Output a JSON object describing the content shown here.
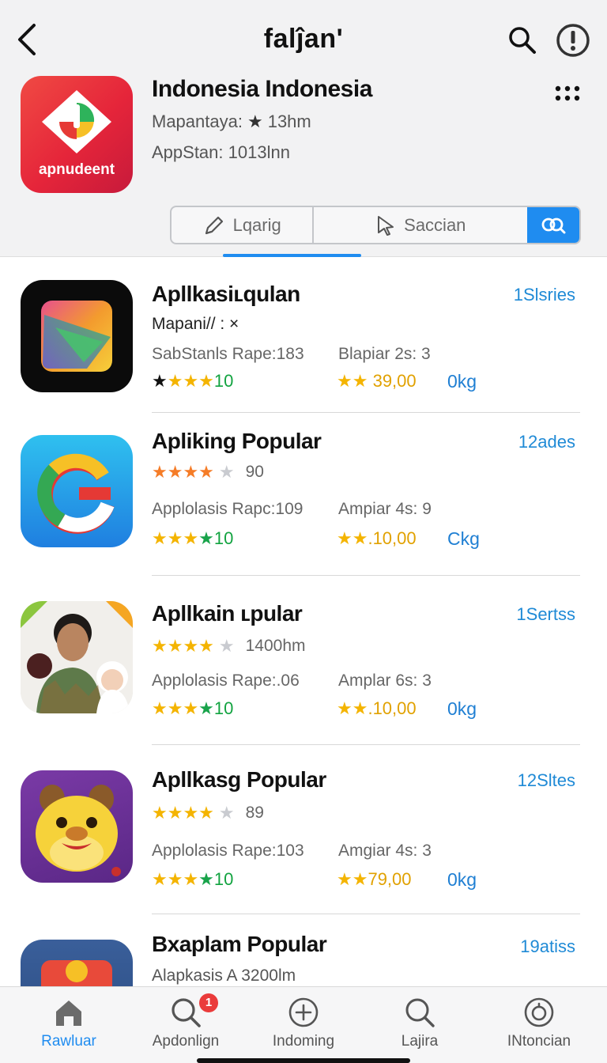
{
  "header": {
    "title": "falĵan'",
    "back_icon": "chevron-left-icon",
    "search_icon": "search-icon",
    "info_icon": "info-icon"
  },
  "app": {
    "name": "Indonesia Indonesia",
    "icon_brand": "apnudeent",
    "meta1_label": "Mapantaya:",
    "meta1_value": "13hm",
    "meta2": "AppStan: 1013lnn",
    "more_icon": "more-dots-icon"
  },
  "segment": {
    "tab1_label": "Lqarig",
    "tab2_label": "Saccian",
    "active_index": 0
  },
  "items": [
    {
      "title": "Apllkasiʟqulan",
      "tag": "1Slsries",
      "sub": "Mapani// : ×",
      "rating_fill": null,
      "left_info": "SabStanls Rape:183",
      "right_info": "Blapiar 2s: 3",
      "left_score": "10",
      "right_score": "39,00",
      "size": "0kg",
      "icon": "stack-icon"
    },
    {
      "title": "Apliking Popular",
      "tag": "12ades",
      "rating": 4,
      "rating_count": "90",
      "left_info": "Applolasis Rapc:109",
      "right_info": "Ampiar 4s: 9",
      "left_score": "10",
      "right_score": ".10,00",
      "size": "Ckg",
      "icon": "g-logo-icon"
    },
    {
      "title": "Apllkain ʟpular",
      "tag": "1Sertss",
      "rating": 4,
      "rating_count": "1400hm",
      "left_info": "Applolasis Rape:.06",
      "right_info": "Amplar 6s: 3",
      "left_score": "10",
      "right_score": ".10,00",
      "size": "0kg",
      "icon": "family-photo-icon"
    },
    {
      "title": "Apllkasg Popular",
      "tag": "12Sltes",
      "rating": 4,
      "rating_count": "89",
      "left_info": "Applolasis Rape:103",
      "right_info": "Amgiar 4s: 3",
      "left_score": "10",
      "right_score": "79,00",
      "size": "0kg",
      "icon": "cartoon-creature-icon"
    },
    {
      "title": "Bxaplam Popular",
      "tag": "19atiss",
      "sub": "Alapkasis A 3200lm",
      "icon": "app-icon"
    }
  ],
  "tabbar": {
    "tabs": [
      {
        "label": "Rawluar",
        "icon": "home-icon"
      },
      {
        "label": "Apdonlign",
        "icon": "search-icon",
        "badge": "1"
      },
      {
        "label": "Indoming",
        "icon": "plus-circle-icon"
      },
      {
        "label": "Lajira",
        "icon": "search-icon"
      },
      {
        "label": "INtoncian",
        "icon": "settings-circle-icon"
      }
    ],
    "active_index": 0
  },
  "colors": {
    "accent": "#1f8cf0",
    "link_blue": "#1f8ad6",
    "star_gold": "#f4b400",
    "green": "#18a34a",
    "badge_red": "#ea3b3b"
  }
}
